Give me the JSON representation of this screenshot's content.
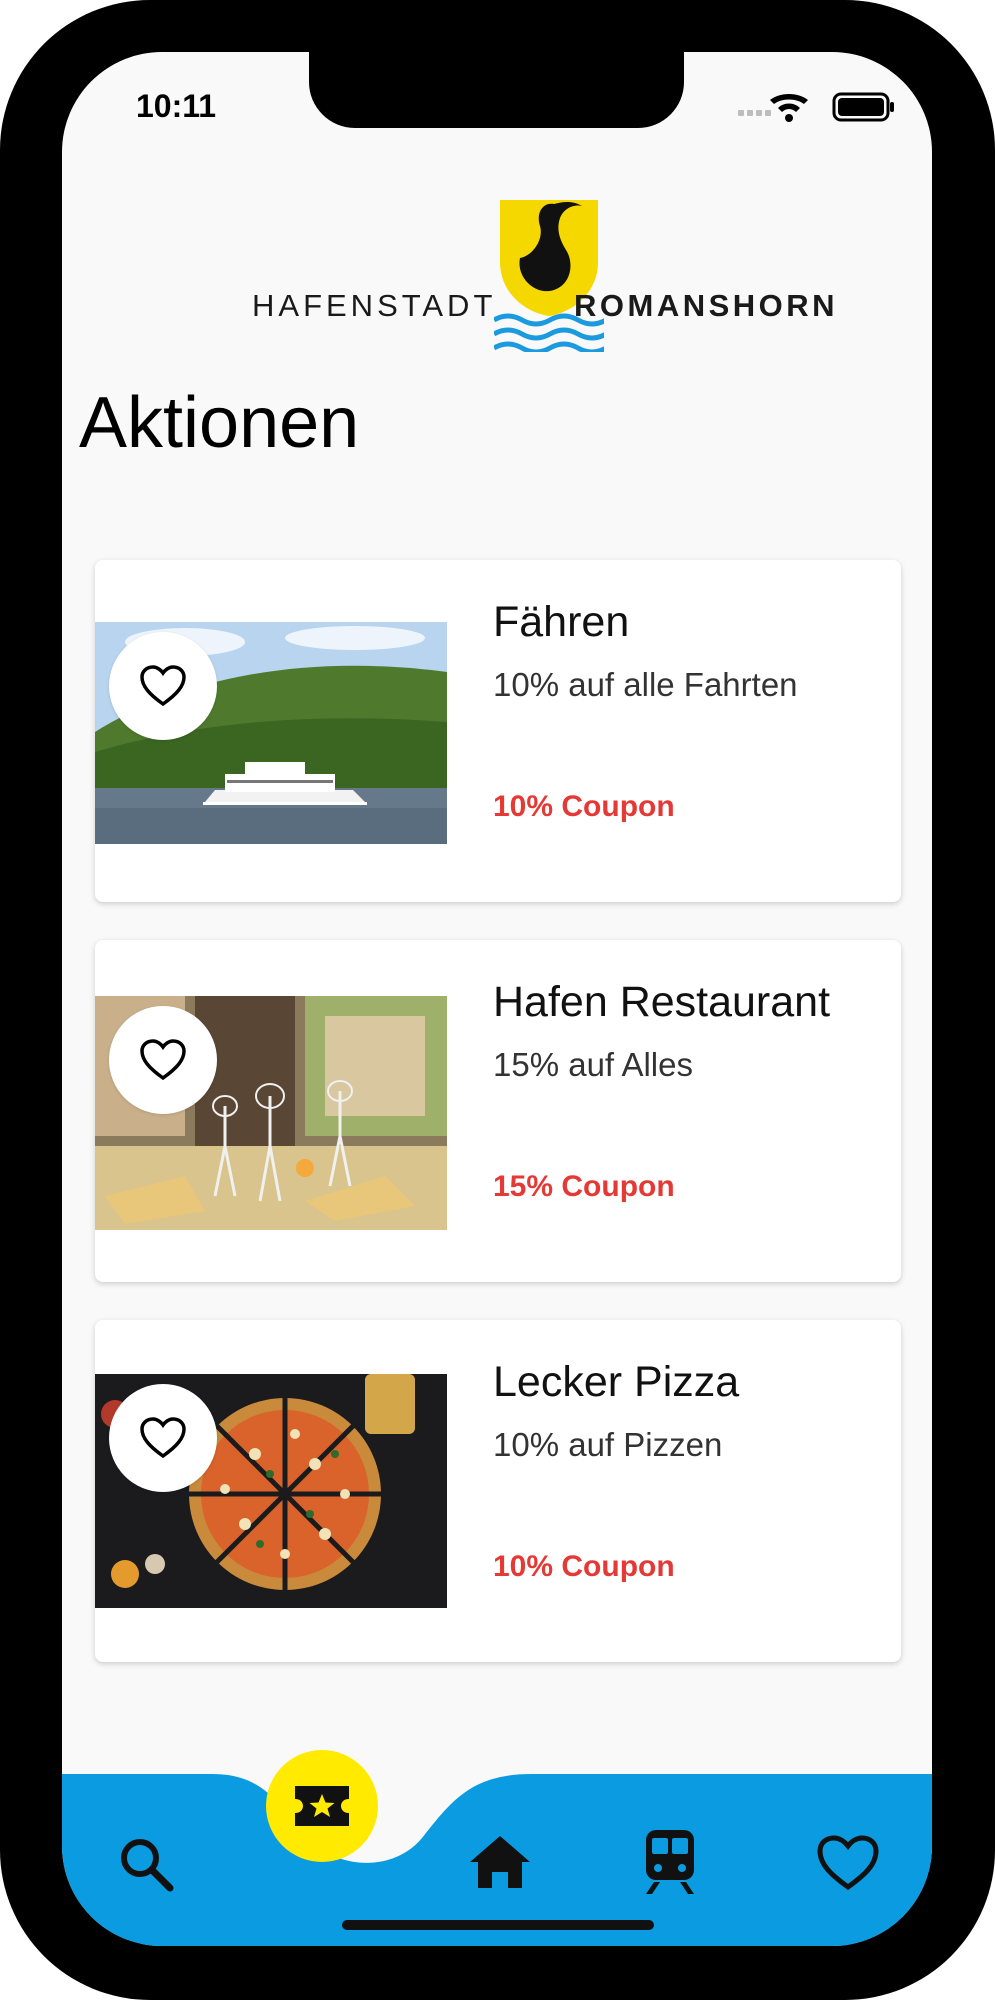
{
  "status_bar": {
    "time": "10:11"
  },
  "logo": {
    "left_text": "HAFENSTADT",
    "right_text": "ROMANSHORN"
  },
  "page": {
    "title": "Aktionen"
  },
  "offers": [
    {
      "title": "Fähren",
      "subtitle": "10% auf alle Fahrten",
      "coupon": "10% Coupon",
      "image": "ferry-photo"
    },
    {
      "title": "Hafen Restaurant",
      "subtitle": "15% auf Alles",
      "coupon": "15% Coupon",
      "image": "restaurant-table-photo"
    },
    {
      "title": "Lecker Pizza",
      "subtitle": "10% auf Pizzen",
      "coupon": "10% Coupon",
      "image": "pizza-photo"
    }
  ],
  "tabbar": {
    "items": [
      "search-icon",
      "ticket-star-icon",
      "home-icon",
      "train-icon",
      "heart-icon"
    ],
    "active": "ticket-star-icon"
  },
  "colors": {
    "accent_blue": "#0a9be0",
    "accent_yellow": "#ffea00",
    "coupon_red": "#e53935"
  }
}
